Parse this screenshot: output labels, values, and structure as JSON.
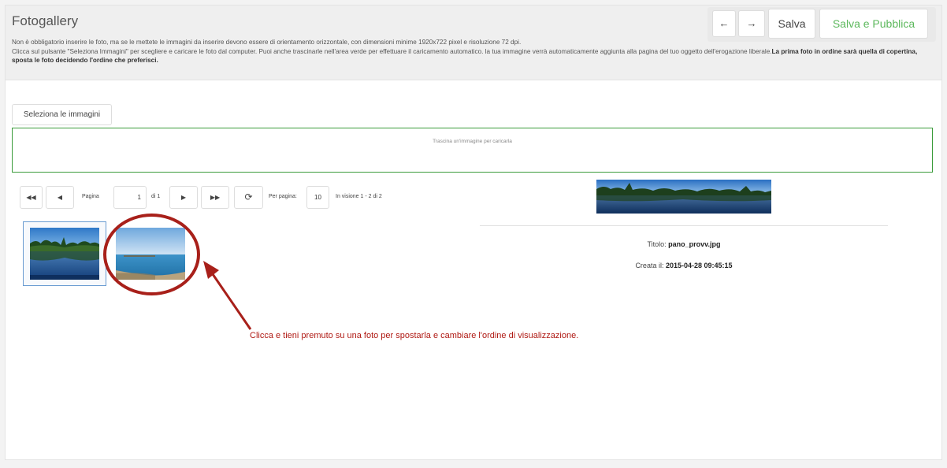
{
  "header": {
    "title": "Fotogallery",
    "info_line1": "Non è obbligatorio inserire le foto, ma se le mettete le immagini da inserire devono essere di orientamento orizzontale, con dimensioni minime 1920x722 pixel e risoluzione 72 dpi.",
    "info_line2": "Clicca sul pulsante \"Seleziona Immagini\" per scegliere e caricare le foto dal computer. Puoi anche trascinarle nell'area verde per effettuare il caricamento automatico. la tua immagine verrà automaticamente aggiunta alla pagina del tuo oggetto dell'erogazione liberale.",
    "info_bold": "La prima foto in ordine sarà quella di copertina, sposta le foto decidendo l'ordine che preferisci."
  },
  "toolbar": {
    "prev_icon": "arrow-left-icon",
    "next_icon": "arrow-right-icon",
    "save_label": "Salva",
    "publish_label": "Salva e Pubblica",
    "publish_color": "#5cb85c"
  },
  "upload": {
    "select_label": "Seleziona le immagini",
    "dropzone_text": "Trascina un'immagine per caricarla",
    "dropzone_color": "#3a9b3a"
  },
  "pager": {
    "first_icon": "first-page-icon",
    "prev_icon": "prev-page-icon",
    "page_label": "Pagina",
    "page_value": "1",
    "of_label": "di 1",
    "next_icon": "next-page-icon",
    "last_icon": "last-page-icon",
    "refresh_icon": "refresh-icon",
    "per_page_label": "Per pagina:",
    "per_page_value": "10",
    "range_label": "In visione 1 - 2 di 2"
  },
  "details": {
    "title_label": "Titolo:",
    "title_value": "pano_provv.jpg",
    "created_label": "Creata il:",
    "created_value": "2015-04-28 09:45:15"
  },
  "annotation": {
    "text": "Clicca e tieni premuto su una foto per spostarla e cambiare l'ordine di visualizzazione.",
    "color": "#b01a14"
  }
}
